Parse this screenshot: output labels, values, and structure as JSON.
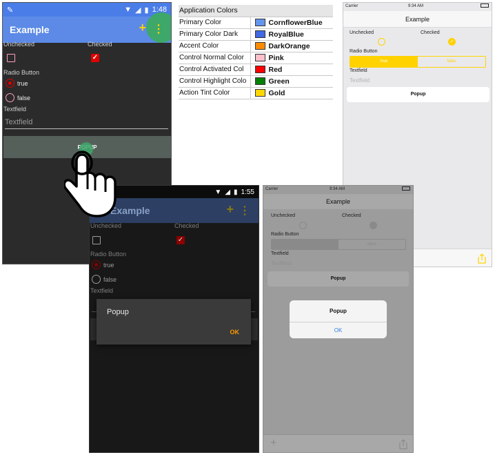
{
  "android_light": {
    "status_time": "1:48",
    "title": "Example",
    "add_icon": "+",
    "more_icon": "⋮",
    "unchecked_label": "Unchecked",
    "checked_label": "Checked",
    "radio_label": "Radio Button",
    "radio_true": "true",
    "radio_false": "false",
    "textfield_label": "Textfield",
    "textfield_placeholder": "Textfield",
    "popup_button": "POPUP"
  },
  "colors_table": {
    "header": "Application Colors",
    "rows": [
      {
        "name": "Primary Color",
        "value": "CornflowerBlue",
        "hex": "#6495ED"
      },
      {
        "name": "Primary Color Dark",
        "value": "RoyalBlue",
        "hex": "#4169E1"
      },
      {
        "name": "Accent Color",
        "value": "DarkOrange",
        "hex": "#FF8C00"
      },
      {
        "name": "Control Normal Color",
        "value": "Pink",
        "hex": "#FFC0CB"
      },
      {
        "name": "Control Activated Col",
        "value": "Red",
        "hex": "#FF0000"
      },
      {
        "name": "Control Highlight Colo",
        "value": "Green",
        "hex": "#008000"
      },
      {
        "name": "Action Tint Color",
        "value": "Gold",
        "hex": "#FFD700"
      }
    ]
  },
  "ios_light": {
    "carrier": "Carrier",
    "time": "9:34 AM",
    "title": "Example",
    "unchecked_label": "Unchecked",
    "checked_label": "Checked",
    "radio_label": "Radio Button",
    "seg_true": "true",
    "seg_false": "false",
    "textfield_label": "Textfield",
    "textfield_placeholder": "Textfield",
    "popup_button": "Popup"
  },
  "android_dark": {
    "status_time": "1:55",
    "title": "Example",
    "add_icon": "+",
    "more_icon": "⋮",
    "unchecked_label": "Unchecked",
    "checked_label": "Checked",
    "radio_label": "Radio Button",
    "radio_true": "true",
    "radio_false": "false",
    "textfield_label": "Textfield",
    "dialog_title": "Popup",
    "dialog_ok": "OK"
  },
  "ios_dim": {
    "carrier": "Carrier",
    "time": "9:34 AM",
    "title": "Example",
    "unchecked_label": "Unchecked",
    "checked_label": "Checked",
    "radio_label": "Radio Button",
    "seg_false": "false",
    "textfield_label": "Textfield",
    "textfield_placeholder": "Textfield",
    "popup_button": "Popup",
    "alert_title": "Popup",
    "alert_ok": "OK"
  }
}
